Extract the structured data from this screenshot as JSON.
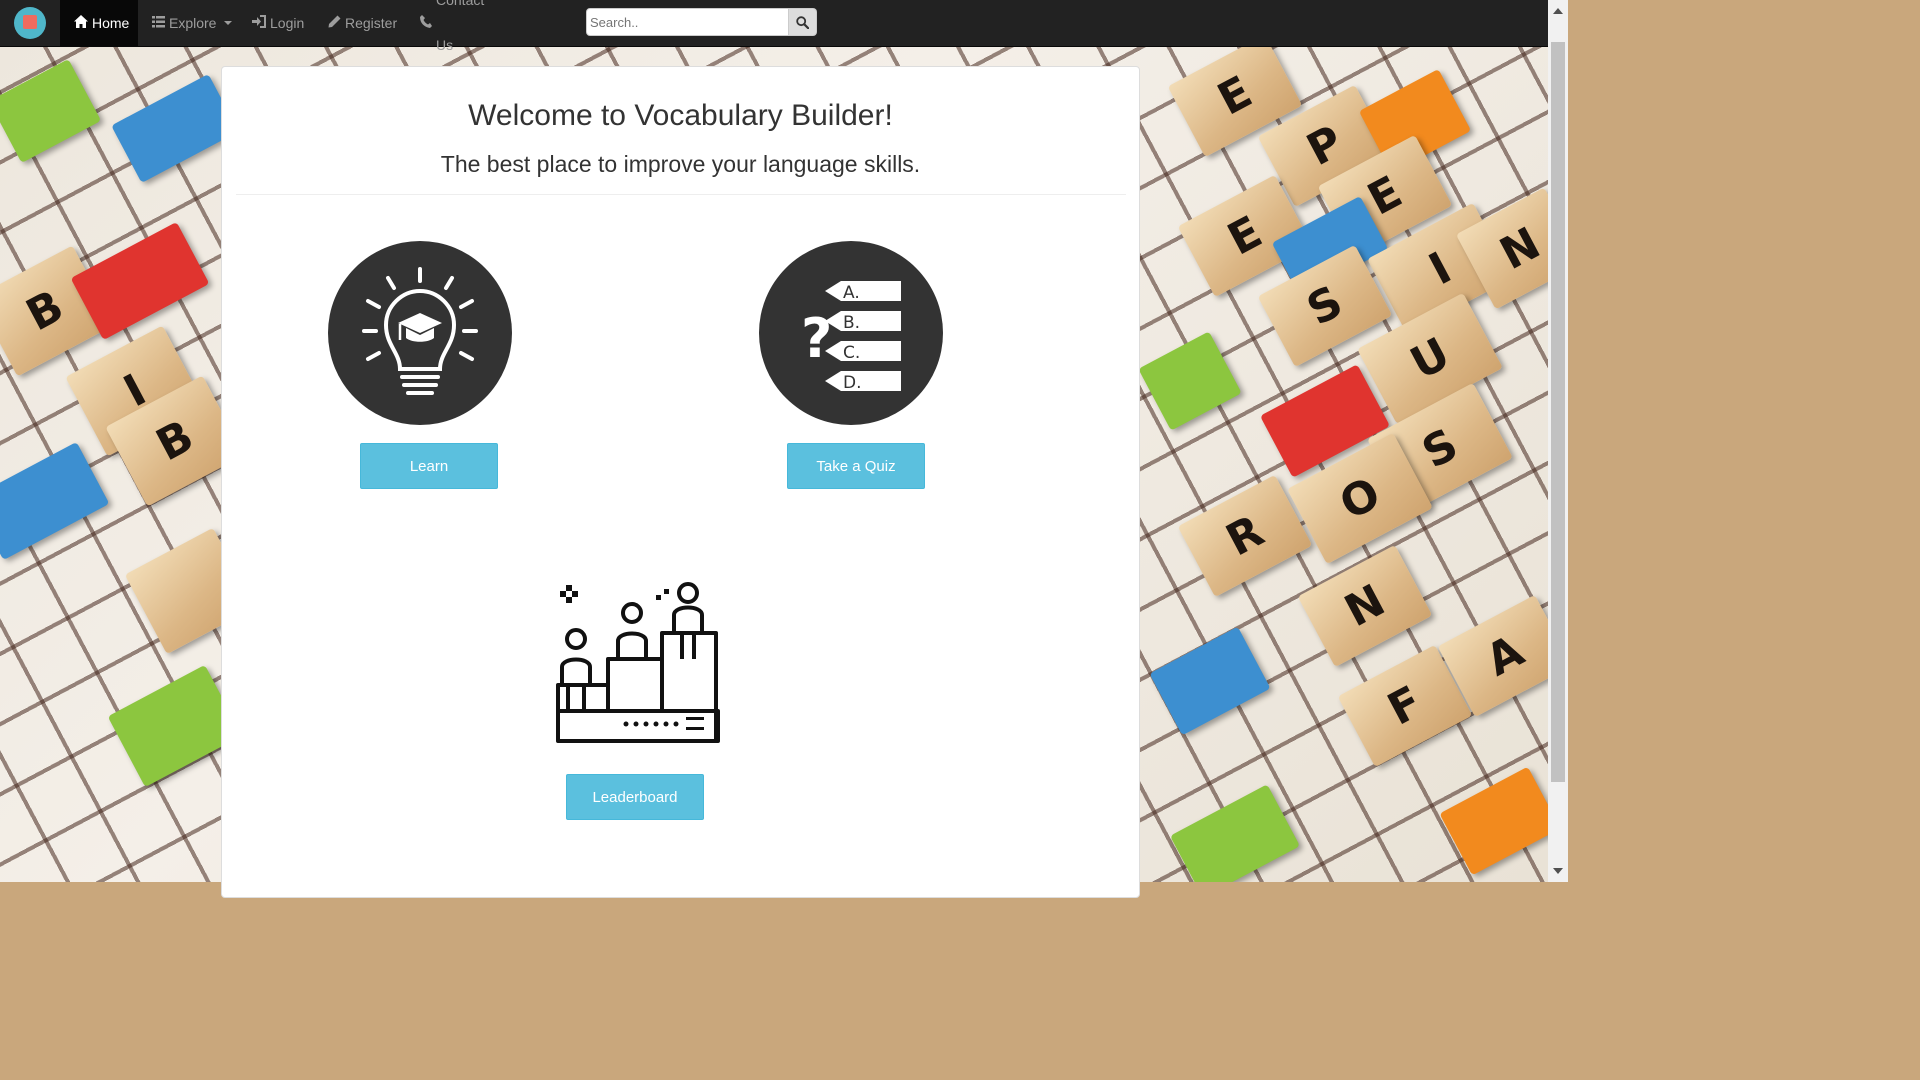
{
  "nav": {
    "brand_icon": "book-logo-icon",
    "items": [
      {
        "label": "Home",
        "icon": "home-icon",
        "active": true
      },
      {
        "label": "Explore",
        "icon": "list-icon",
        "dropdown": true
      },
      {
        "label": "Login",
        "icon": "login-icon"
      },
      {
        "label": "Register",
        "icon": "pencil-icon"
      },
      {
        "label": "Contact Us",
        "icon": "phone-icon"
      }
    ],
    "search": {
      "placeholder": "Search..",
      "value": "",
      "icon": "search-icon"
    }
  },
  "main": {
    "title": "Welcome to Vocabulary Builder!",
    "subtitle": "The best place to improve your language skills.",
    "cards": [
      {
        "label": "Learn",
        "icon": "lightbulb-graduation-icon"
      },
      {
        "label": "Take a Quiz",
        "icon": "quiz-options-icon",
        "options": [
          "A.",
          "B.",
          "C.",
          "D."
        ]
      },
      {
        "label": "Leaderboard",
        "icon": "podium-icon"
      }
    ]
  },
  "colors": {
    "navbar": "#222222",
    "button": "#5bc0de",
    "icon_dark": "#333333"
  }
}
